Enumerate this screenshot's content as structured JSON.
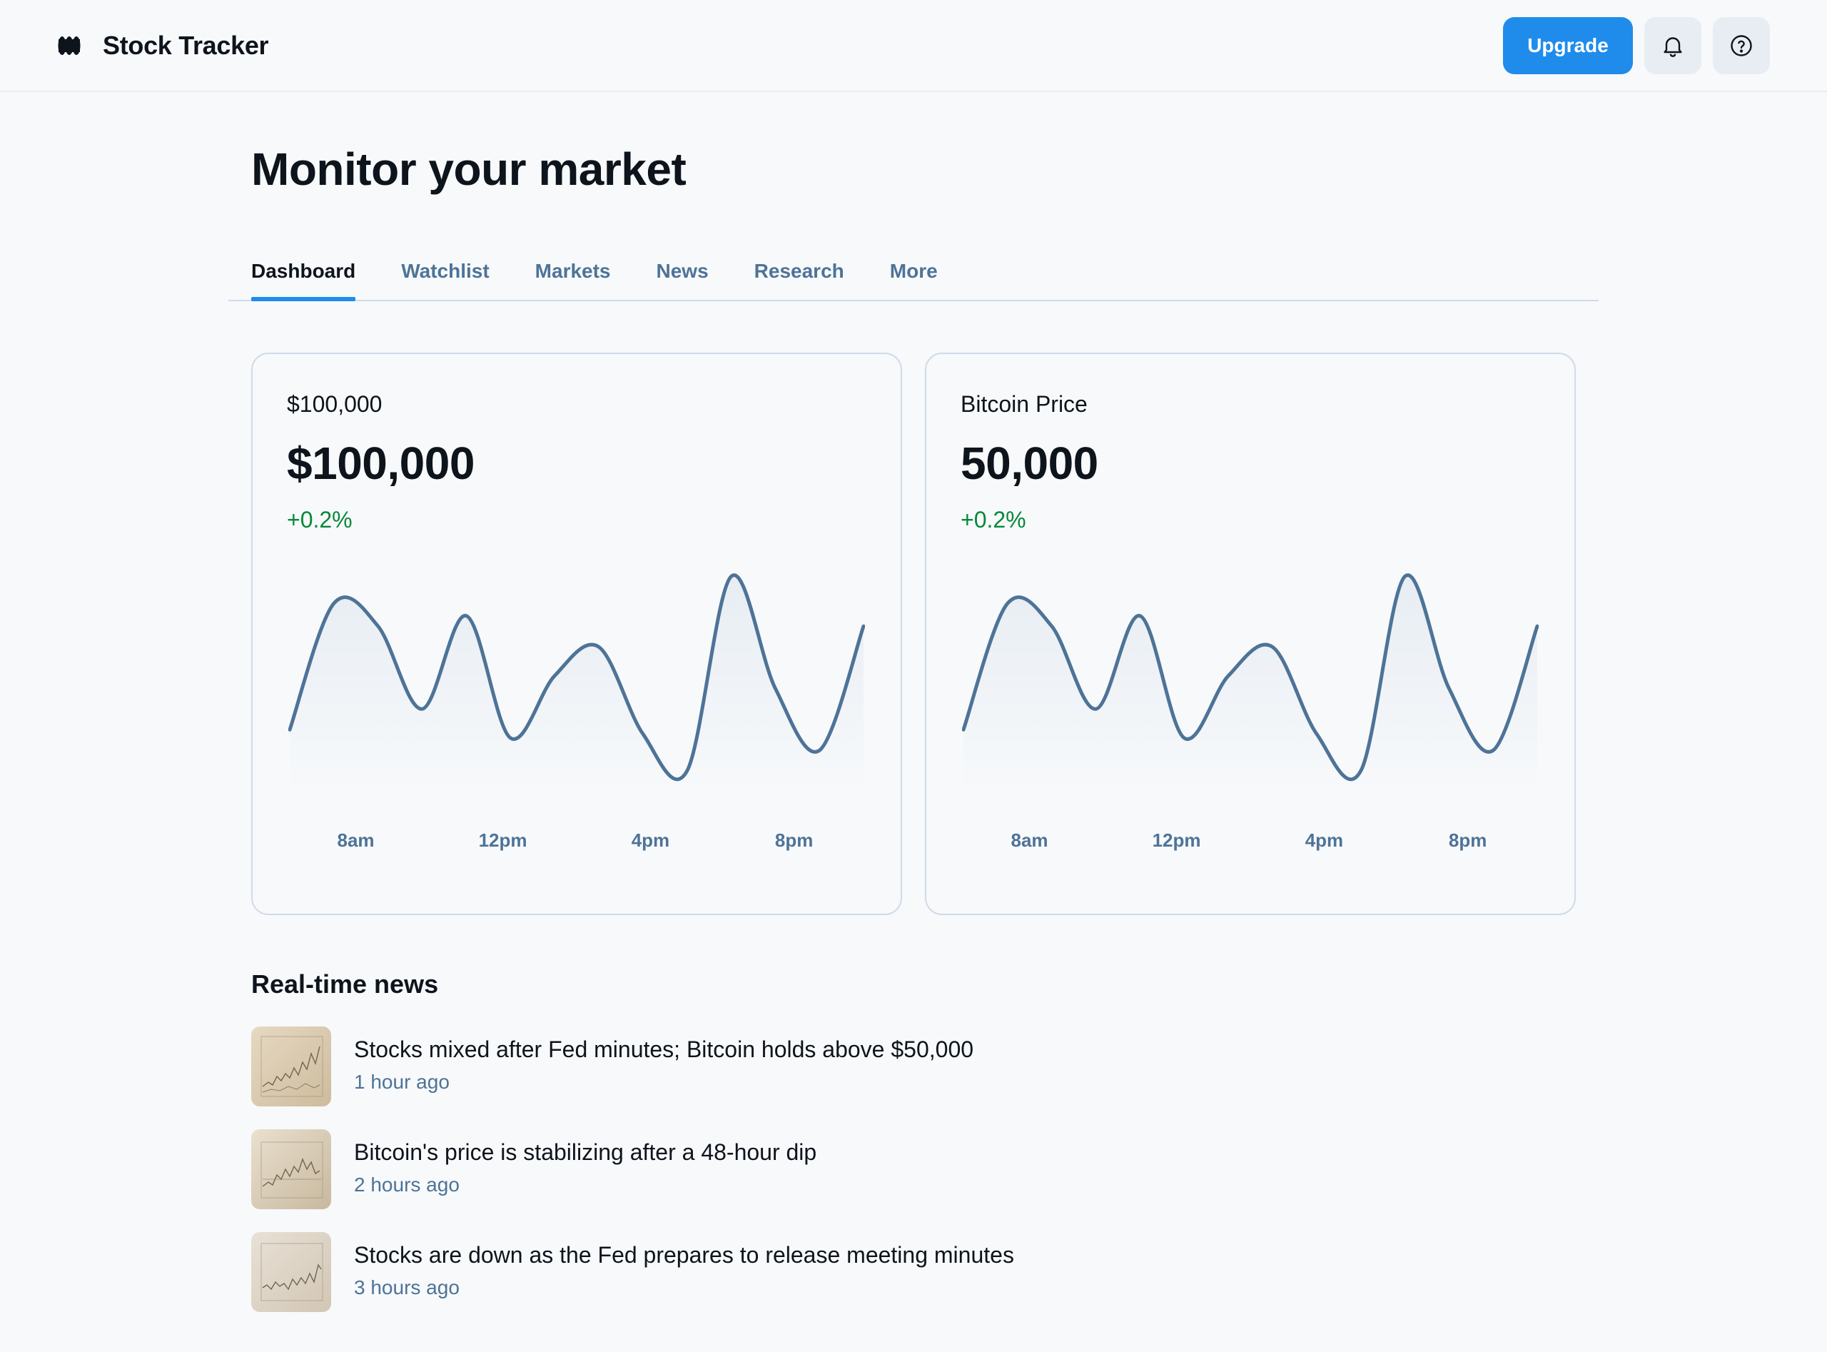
{
  "header": {
    "brand_title": "Stock Tracker",
    "brand_icon": "logo-icon",
    "upgrade_label": "Upgrade",
    "notification_icon": "bell-icon",
    "help_icon": "help-circle-icon"
  },
  "page": {
    "title": "Monitor your market"
  },
  "tabs": [
    {
      "label": "Dashboard",
      "active": true
    },
    {
      "label": "Watchlist",
      "active": false
    },
    {
      "label": "Markets",
      "active": false
    },
    {
      "label": "News",
      "active": false
    },
    {
      "label": "Research",
      "active": false
    },
    {
      "label": "More",
      "active": false
    }
  ],
  "cards": [
    {
      "label": "$100,000",
      "value": "$100,000",
      "change": "+0.2%",
      "x_labels": [
        "8am",
        "12pm",
        "4pm",
        "8pm"
      ]
    },
    {
      "label": "Bitcoin Price",
      "value": "50,000",
      "change": "+0.2%",
      "x_labels": [
        "8am",
        "12pm",
        "4pm",
        "8pm"
      ]
    }
  ],
  "chart_data": [
    {
      "type": "area",
      "x": [
        "8am",
        "12pm",
        "4pm",
        "8pm"
      ],
      "series": [
        {
          "values": [
            22,
            83,
            72,
            32,
            77,
            18,
            48,
            62,
            20,
            2,
            96,
            42,
            12,
            72
          ]
        }
      ],
      "xlabel": "",
      "ylabel": "",
      "grid": false
    },
    {
      "type": "area",
      "x": [
        "8am",
        "12pm",
        "4pm",
        "8pm"
      ],
      "series": [
        {
          "values": [
            22,
            83,
            72,
            32,
            77,
            18,
            48,
            62,
            20,
            2,
            96,
            42,
            12,
            72
          ]
        }
      ],
      "xlabel": "",
      "ylabel": "",
      "grid": false
    }
  ],
  "news": {
    "heading": "Real-time news",
    "items": [
      {
        "title": "Stocks mixed after Fed minutes; Bitcoin holds above $50,000",
        "time": "1 hour ago",
        "thumb_icon": "chart-thumbnail-icon"
      },
      {
        "title": "Bitcoin's price is stabilizing after a 48-hour dip",
        "time": "2 hours ago",
        "thumb_icon": "chart-thumbnail-icon"
      },
      {
        "title": "Stocks are down as the Fed prepares to release meeting minutes",
        "time": "3 hours ago",
        "thumb_icon": "chart-thumbnail-icon"
      }
    ]
  },
  "colors": {
    "accent": "#1f8ceb",
    "text_primary": "#0e141b",
    "text_secondary": "#4e7397",
    "positive": "#078838",
    "line": "#4e7397",
    "border": "#d0dbe7",
    "background": "#f7f9fb"
  }
}
